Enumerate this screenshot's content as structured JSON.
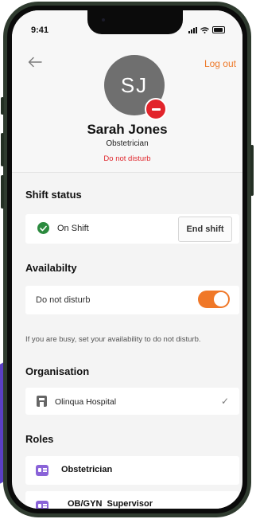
{
  "status_bar": {
    "time": "9:41"
  },
  "header": {
    "logout_label": "Log out",
    "avatar_initials": "SJ",
    "name": "Sarah Jones",
    "role": "Obstetrician",
    "status": "Do not disturb"
  },
  "shift": {
    "section_title": "Shift status",
    "status_label": "On Shift",
    "end_button_label": "End shift"
  },
  "availability": {
    "section_title": "Availabilty",
    "toggle_label": "Do not disturb",
    "toggle_on": true,
    "helper_text": "If you are busy, set your availability to do not disturb."
  },
  "organisation": {
    "section_title": "Organisation",
    "name": "Olinqua Hospital",
    "check_icon": "✓"
  },
  "roles": {
    "section_title": "Roles",
    "items": [
      {
        "label": "Obstetrician"
      },
      {
        "label": "OB/GYN  Supervisor"
      }
    ]
  },
  "colors": {
    "accent": "#ee7a2a",
    "danger": "#e0282e",
    "success": "#2b8a3e",
    "role_icon": "#8a63d8"
  },
  "icons": {
    "back": "arrow-left-icon",
    "status_badge": "minus-circle-icon",
    "on_shift": "check-circle-icon",
    "organisation": "hospital-icon",
    "role": "id-card-icon"
  }
}
